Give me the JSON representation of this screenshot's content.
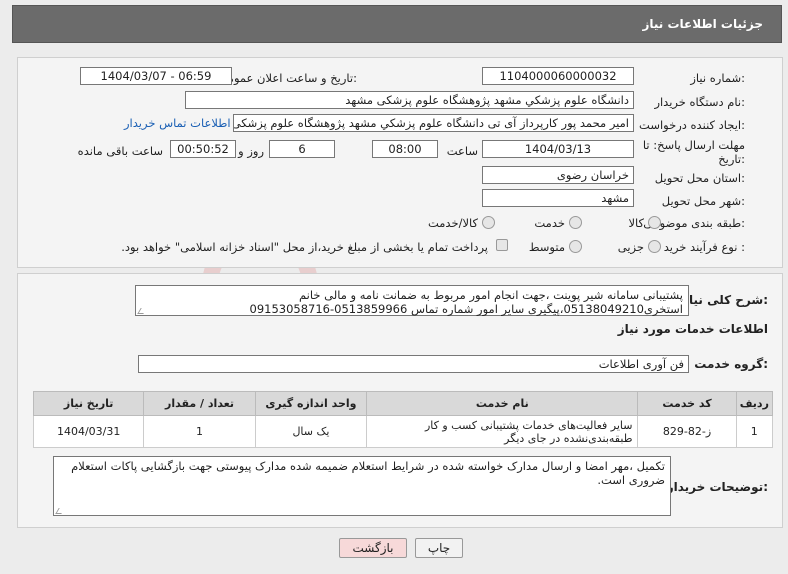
{
  "header": {
    "title": "جزئیات اطلاعات نیاز"
  },
  "need": {
    "number_label": "شماره نیاز:",
    "number": "1104000060000032",
    "announce_label": "تاریخ و ساعت اعلان عمومی:",
    "announce": "1404/03/07 - 06:59",
    "buyer_label": "نام دستگاه خریدار:",
    "buyer": "دانشگاه علوم پزشکي مشهد   پژوهشگاه علوم پزشکی مشهد",
    "creator_label": "ایجاد کننده درخواست:",
    "creator": "امیر محمد پور کارپرداز آی تی دانشگاه علوم پزشکي مشهد   پژوهشگاه علوم پزشکی مشهد",
    "contact_link": "اطلاعات تماس خریدار",
    "deadline_label_1": "مهلت ارسال پاسخ: تا",
    "deadline_label_2": "تاریخ:",
    "deadline_date": "1404/03/13",
    "time_label": "ساعت",
    "deadline_time": "08:00",
    "days": "6",
    "days_label": "روز و",
    "remaining": "00:50:52",
    "remaining_label": "ساعت باقی مانده",
    "province_label": "استان محل تحویل:",
    "province": "خراسان رضوی",
    "city_label": "شهر محل تحویل:",
    "city": "مشهد",
    "category_label": "طبقه بندی موضوعی:",
    "cat_goods": "کالا",
    "cat_service": "خدمت",
    "cat_both": "کالا/خدمت",
    "process_label": "نوع فرآیند خرید :",
    "proc_partial": "جزیی",
    "proc_medium": "متوسط",
    "payment_note": "پرداخت تمام یا بخشی از مبلغ خرید،از محل \"اسناد خزانه اسلامی\" خواهد بود."
  },
  "summary": {
    "label": "شرح کلی نیاز:",
    "text": "پشتیبانی سامانه شیر پوینت ،جهت انجام امور مربوط به ضمانت نامه و مالی خانم استخری05138049210،پیگیری سایر امور شماره تماس 0513859966-09153058716"
  },
  "services": {
    "section_title": "اطلاعات خدمات مورد نیاز",
    "group_label": "گروه خدمت:",
    "group": "فن آوری اطلاعات",
    "columns": [
      "ردیف",
      "کد خدمت",
      "نام خدمت",
      "واحد اندازه گیری",
      "تعداد / مقدار",
      "تاریخ نیاز"
    ],
    "rows": [
      [
        "1",
        "ز-82-829",
        "سایر فعالیت‌های خدمات پشتیبانی کسب و کار طبقه‌بندی‌نشده در جای دیگر",
        "یک سال",
        "1",
        "1404/03/31"
      ]
    ]
  },
  "buyer_notes": {
    "label": "توضیحات خریدار:",
    "text": "تکمیل ،مهر امضا و ارسال مدارک خواسته شده در شرایط استعلام ضمیمه شده مدارک پیوستی جهت بازگشایی پاکات استعلام ضروری است."
  },
  "buttons": {
    "print": "چاپ",
    "back": "بازگشت"
  },
  "colors": {
    "header_bg": "#6b6b6b",
    "link": "#1a5fb4",
    "back_btn": "#f7d9d9"
  }
}
